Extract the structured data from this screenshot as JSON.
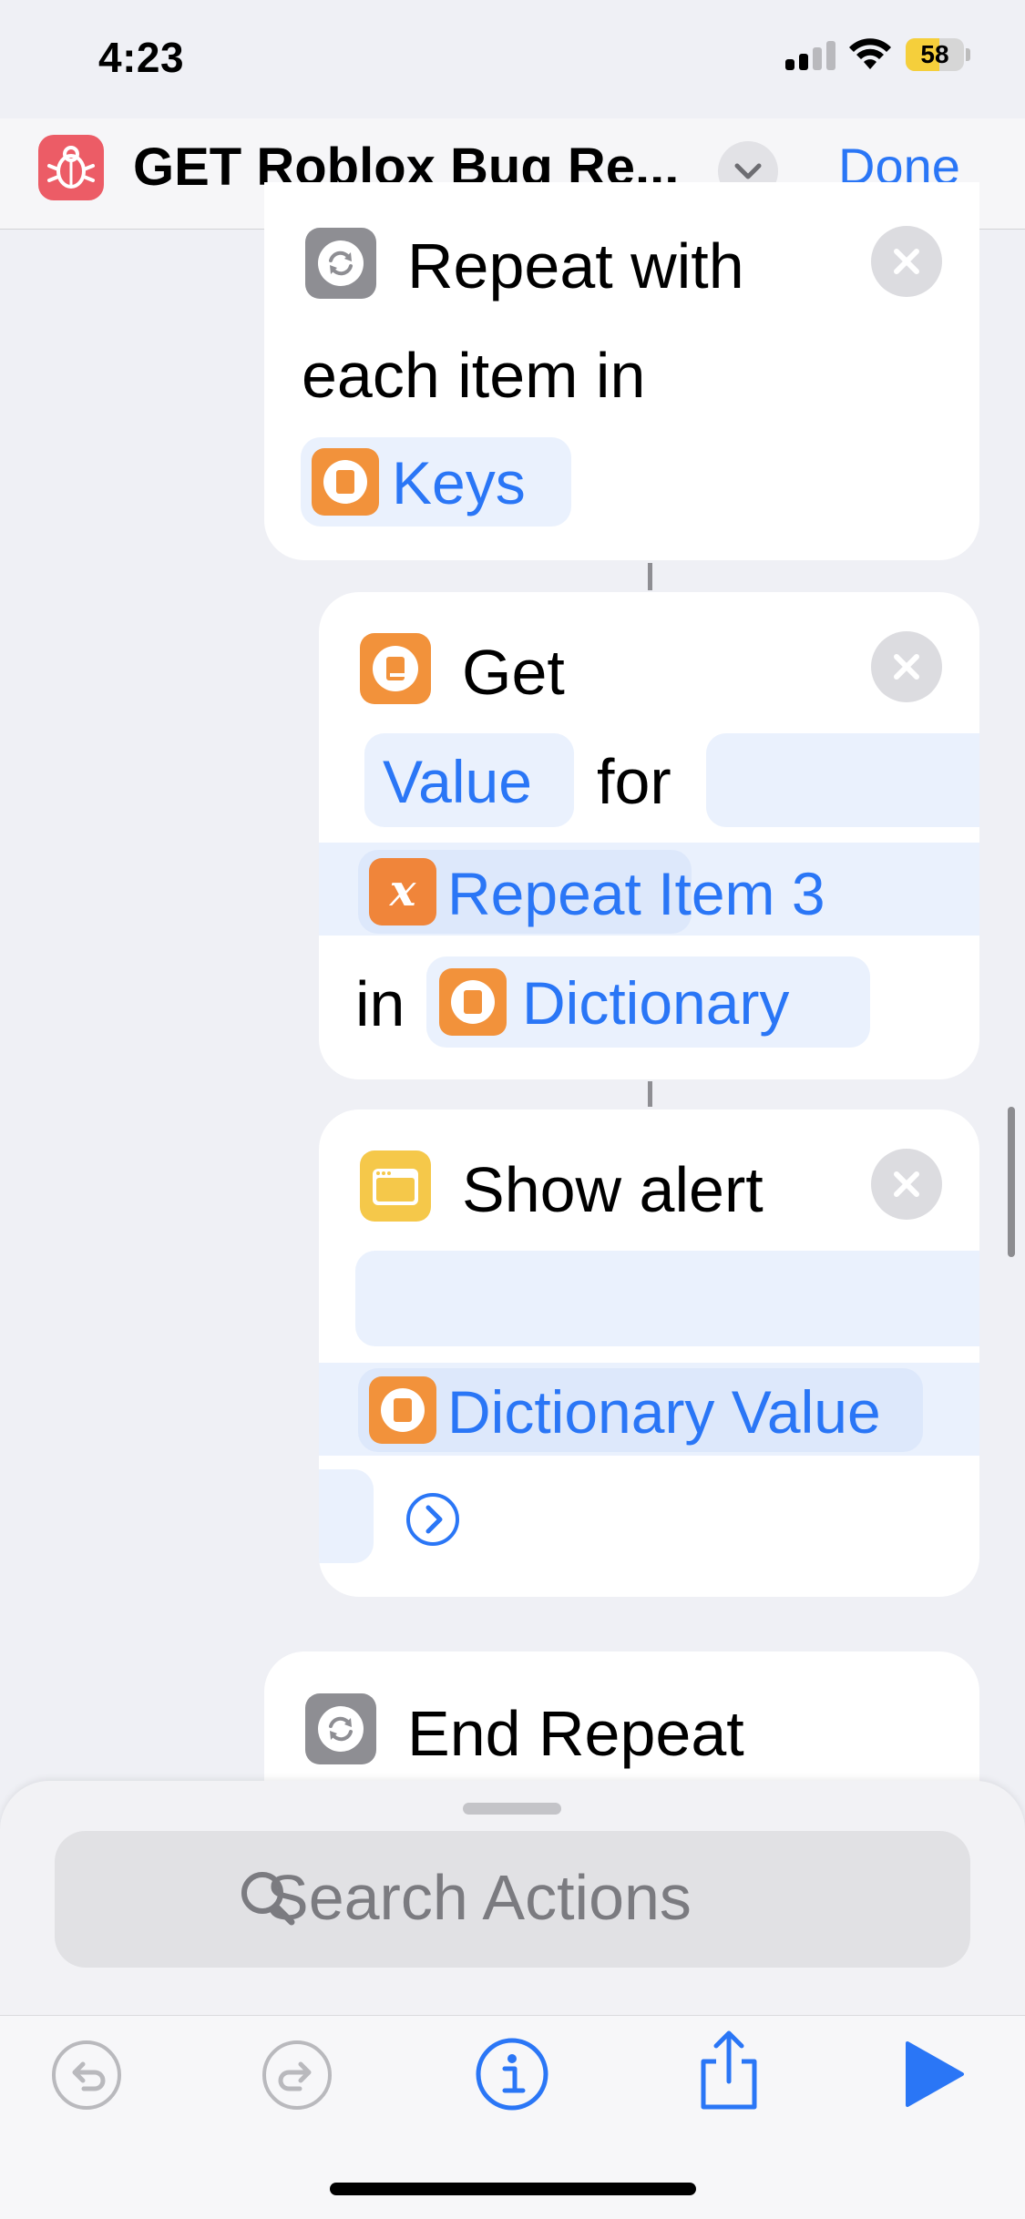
{
  "status_bar": {
    "time": "4:23",
    "battery": "58",
    "battery_level": 0.58
  },
  "nav": {
    "app_icon": "bug-icon",
    "title": "GET Roblox Bug Re...",
    "done": "Done"
  },
  "actions": {
    "repeat": {
      "icon": "repeat-icon",
      "label_line1": "Repeat with",
      "label_line2": "each item in",
      "token": "Keys",
      "token_icon": "dictionary-icon"
    },
    "get_value": {
      "icon": "dictionary-icon",
      "label": "Get",
      "token_value": "Value",
      "for_text": "for",
      "token_repeat_item": "Repeat Item 3",
      "token_repeat_icon": "variable-icon",
      "in_text": "in",
      "token_dictionary": "Dictionary"
    },
    "show_alert": {
      "icon": "alert-window-icon",
      "label": "Show alert",
      "token": "Dictionary Value",
      "expand_icon": "chevron-right-circle-icon"
    },
    "end_repeat": {
      "icon": "repeat-icon",
      "label": "End Repeat"
    }
  },
  "search": {
    "placeholder": "Search Actions"
  },
  "toolbar": {
    "undo": "undo-icon",
    "redo": "redo-icon",
    "info": "info-icon",
    "share": "share-icon",
    "run": "play-icon"
  },
  "colors": {
    "accent": "#2a76f6",
    "token_bg": "#eaf1fd",
    "dictionary_orange": "#f2923b",
    "alert_yellow": "#f5c84a",
    "app_icon_red": "#ec5c66"
  }
}
